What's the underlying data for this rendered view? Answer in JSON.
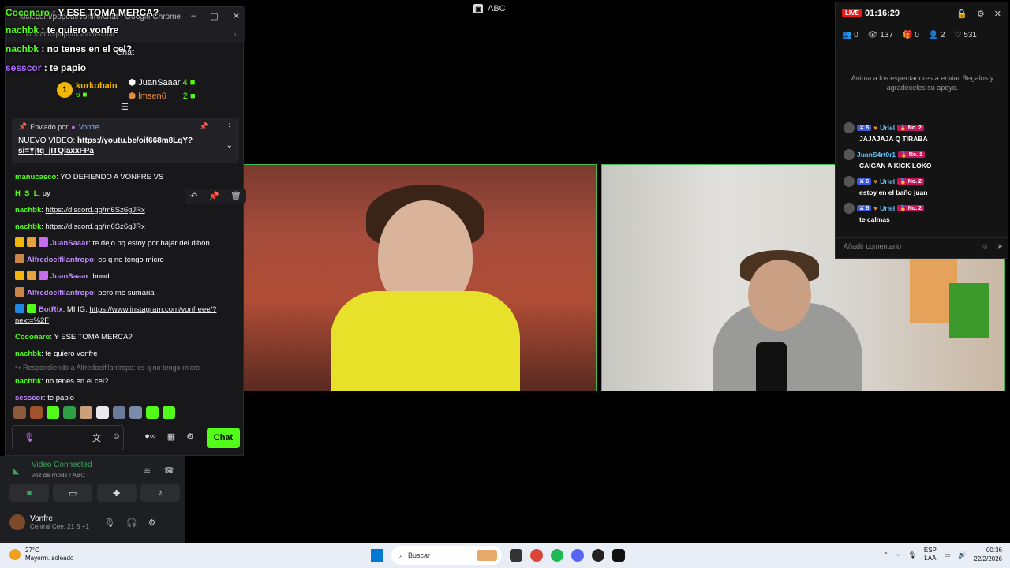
{
  "top_title": {
    "icon": "window-icon",
    "label": "ABC"
  },
  "chat_window": {
    "browser_title": "kick.com/popout/vonfre/chat - Google Chrome",
    "url": "kick.com/popout/vonfre/chat",
    "overlay_messages": [
      {
        "user": "Coconaro",
        "text": "Y ESE TOMA MERCA?",
        "color": "#53fc18"
      },
      {
        "user": "nachbk",
        "text": "te quiero vonfre",
        "color": "#53fc18"
      },
      {
        "user": "nachbk",
        "text": "no tenes en el cel?",
        "color": "#53fc18"
      },
      {
        "user": "sesscor",
        "text": "te papio",
        "color": "#b06cff"
      }
    ],
    "chat_label": "Chat",
    "leaderboard": [
      {
        "rank": "1",
        "name": "kurkobain",
        "count": "6",
        "name_color": "#f2b705"
      },
      {
        "rank": "",
        "name": "JuanSaaar",
        "count": "4",
        "name_color": "#fff"
      },
      {
        "rank": "",
        "name": "lmsen6",
        "count": "2",
        "name_color": "#e38b3c"
      }
    ],
    "pinned": {
      "sent_by_label": "Enviado por",
      "sender": "Vonfre",
      "text_prefix": "NUEVO VIDEO:",
      "link": "https://youtu.be/oif668m8LqY?si=Yjtq_jITQlaxxFPa"
    },
    "messages": [
      {
        "user": "manucasco",
        "text": "YO DEFIENDO A VONFRE VS",
        "color": "#53fc18",
        "badges": []
      },
      {
        "user": "H_S_L",
        "text": "uy",
        "color": "#53fc18",
        "badges": []
      },
      {
        "user": "nachbk",
        "text": "https://discord.gg/m6Sz6gJRx",
        "color": "#53fc18",
        "badges": [],
        "link": true
      },
      {
        "user": "nachbk",
        "text": "https://discord.gg/m6Sz6gJRx",
        "color": "#53fc18",
        "badges": [],
        "link": true
      },
      {
        "user": "JuanSaaar",
        "text": "te dejo pq estoy por bajar del dibon",
        "color": "#c08cff",
        "badges": [
          "#f2b705",
          "#e6a23c",
          "#c56cf0"
        ]
      },
      {
        "user": "Alfredoelfilantropo",
        "text": "es q no tengo micro",
        "color": "#c08cff",
        "badges": [
          "#c9854b"
        ]
      },
      {
        "user": "JuanSaaar",
        "text": "bondi",
        "color": "#c08cff",
        "badges": [
          "#f2b705",
          "#e6a23c",
          "#c56cf0"
        ]
      },
      {
        "user": "Alfredoelfilantropo",
        "text": "pero me sumaria",
        "color": "#c08cff",
        "badges": [
          "#c9854b"
        ]
      },
      {
        "user": "BotRix",
        "text": "MI IG: https://www.instagram.com/vonfreee/?next=%2F",
        "color": "#c08cff",
        "badges": [
          "#1e88e5",
          "#53fc18"
        ],
        "link": true
      },
      {
        "user": "Coconaro",
        "text": "Y ESE TOMA MERCA?",
        "color": "#53fc18",
        "badges": []
      },
      {
        "user": "nachbk",
        "text": "te quiero vonfre",
        "color": "#53fc18",
        "badges": []
      },
      {
        "user": "nachbk",
        "text": "no tenes en el cel?",
        "color": "#53fc18",
        "badges": [],
        "reply": "Respondiendo a Alfredoelfilantropo: es q no tengo micro"
      },
      {
        "user": "sesscor",
        "text": "te papio",
        "color": "#c08cff",
        "badges": []
      }
    ],
    "emote_colors": [
      "#8a5a3a",
      "#a0522d",
      "#53fc18",
      "#2ea043",
      "#c9a07a",
      "#e9e9e9",
      "#6b7a99",
      "#7a8aa9",
      "#53fc18",
      "#53fc18"
    ],
    "chat_button": "Chat"
  },
  "discord": {
    "status": "Video Connected",
    "sub": "voz de mods / ABC",
    "username": "Vonfre",
    "user_status": "Central Cee, 21 S +1"
  },
  "right_panel": {
    "live_badge": "LIVE",
    "timer": "01:16:29",
    "stats": [
      {
        "icon": "users-icon",
        "value": "0"
      },
      {
        "icon": "eye-icon",
        "value": "137"
      },
      {
        "icon": "gift-icon",
        "value": "0"
      },
      {
        "icon": "follow-icon",
        "value": "2"
      },
      {
        "icon": "heart-icon",
        "value": "531"
      }
    ],
    "hint": "Anima a los espectadores a enviar Regalos y agradéceles su apoyo.",
    "messages": [
      {
        "badges": "5",
        "user": "Uriel",
        "rank": "No. 2",
        "text": "JAJAJAJA Q TIRABA"
      },
      {
        "badges": "",
        "user": "JuanS4rt0r1",
        "rank": "No. 1",
        "text": "CAIGAN A KICK LOKO"
      },
      {
        "badges": "5",
        "user": "Uriel",
        "rank": "No. 2",
        "text": "estoy en el baño juan"
      },
      {
        "badges": "5",
        "user": "Uriel",
        "rank": "No. 2",
        "text": "te calmas"
      }
    ],
    "input_placeholder": "Añadir comentario"
  },
  "taskbar": {
    "temp": "27°C",
    "weather": "Mayorm. soleado",
    "search": "Buscar",
    "lang1": "ESP",
    "lang2": "LAA",
    "time": "00:36",
    "date": "22/2/2026"
  }
}
